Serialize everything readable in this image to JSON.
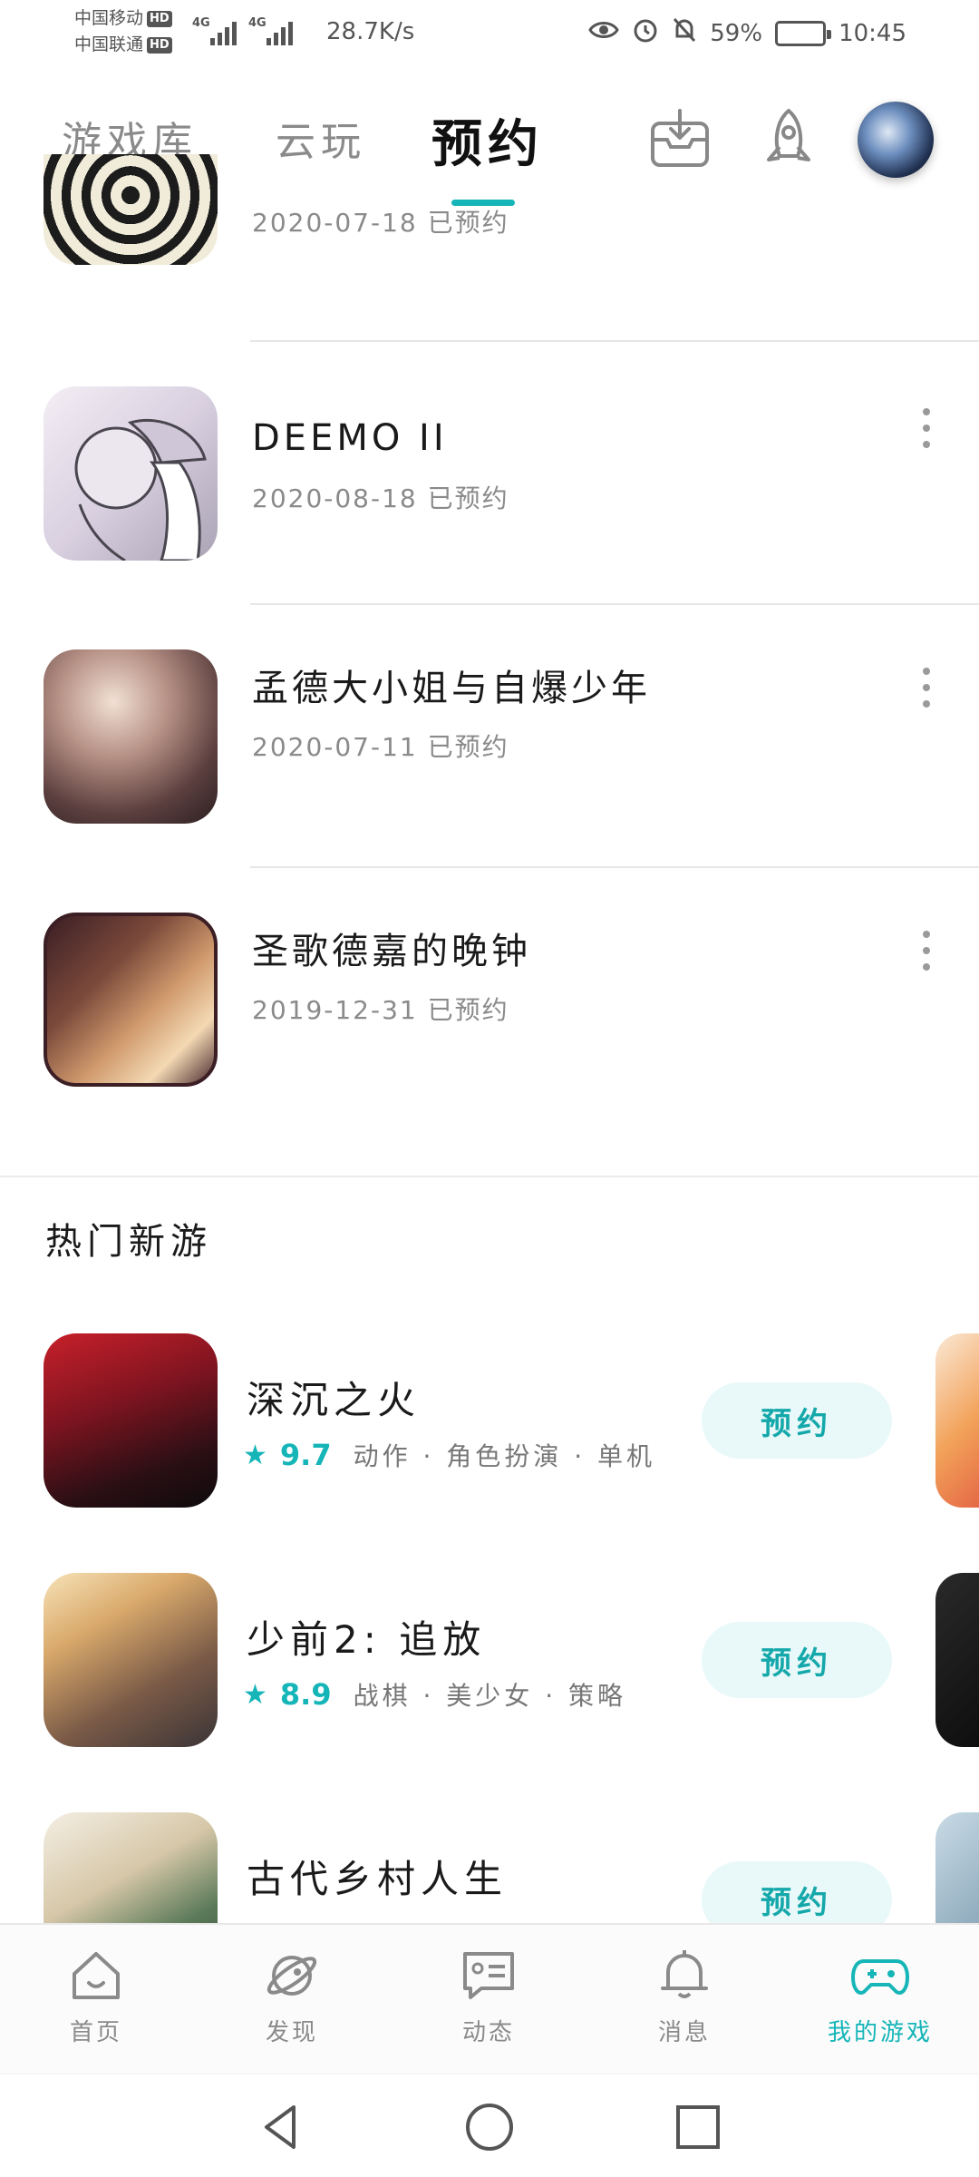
{
  "status_bar": {
    "carrier1": "中国移动",
    "carrier2": "中国联通",
    "hd_badge": "HD",
    "net_type": "4G",
    "speed": "28.7K/s",
    "battery": "59%",
    "battery_level": 0.59,
    "time": "10:45"
  },
  "top_tabs": {
    "tabs": [
      {
        "label": "游戏库"
      },
      {
        "label": "云玩"
      },
      {
        "label": "预约"
      }
    ],
    "active_index": 2
  },
  "reservations": [
    {
      "title": "",
      "date": "2020-07-18 已预约"
    },
    {
      "title": "DEEMO II",
      "date": "2020-08-18 已预约"
    },
    {
      "title": "孟德大小姐与自爆少年",
      "date": "2020-07-11 已预约"
    },
    {
      "title": "圣歌德嘉的晚钟",
      "date": "2019-12-31 已预约"
    }
  ],
  "hot_section": {
    "title": "热门新游",
    "games": [
      {
        "title": "深沉之火",
        "score": "9.7",
        "tags": "动作 · 角色扮演 · 单机",
        "button": "预约"
      },
      {
        "title": "少前2: 追放",
        "score": "8.9",
        "tags": "战棋 · 美少女 · 策略",
        "button": "预约"
      },
      {
        "title": "古代乡村人生",
        "score": "",
        "tags": "",
        "button": "预约"
      }
    ]
  },
  "bottom_nav": {
    "items": [
      {
        "label": "首页",
        "icon": "home-icon"
      },
      {
        "label": "发现",
        "icon": "discover-planet-icon"
      },
      {
        "label": "动态",
        "icon": "chat-card-icon"
      },
      {
        "label": "消息",
        "icon": "bell-icon"
      },
      {
        "label": "我的游戏",
        "icon": "gamepad-icon"
      }
    ],
    "active_index": 4
  },
  "colors": {
    "accent": "#15b5b8",
    "button_bg": "#e9f8f8"
  }
}
